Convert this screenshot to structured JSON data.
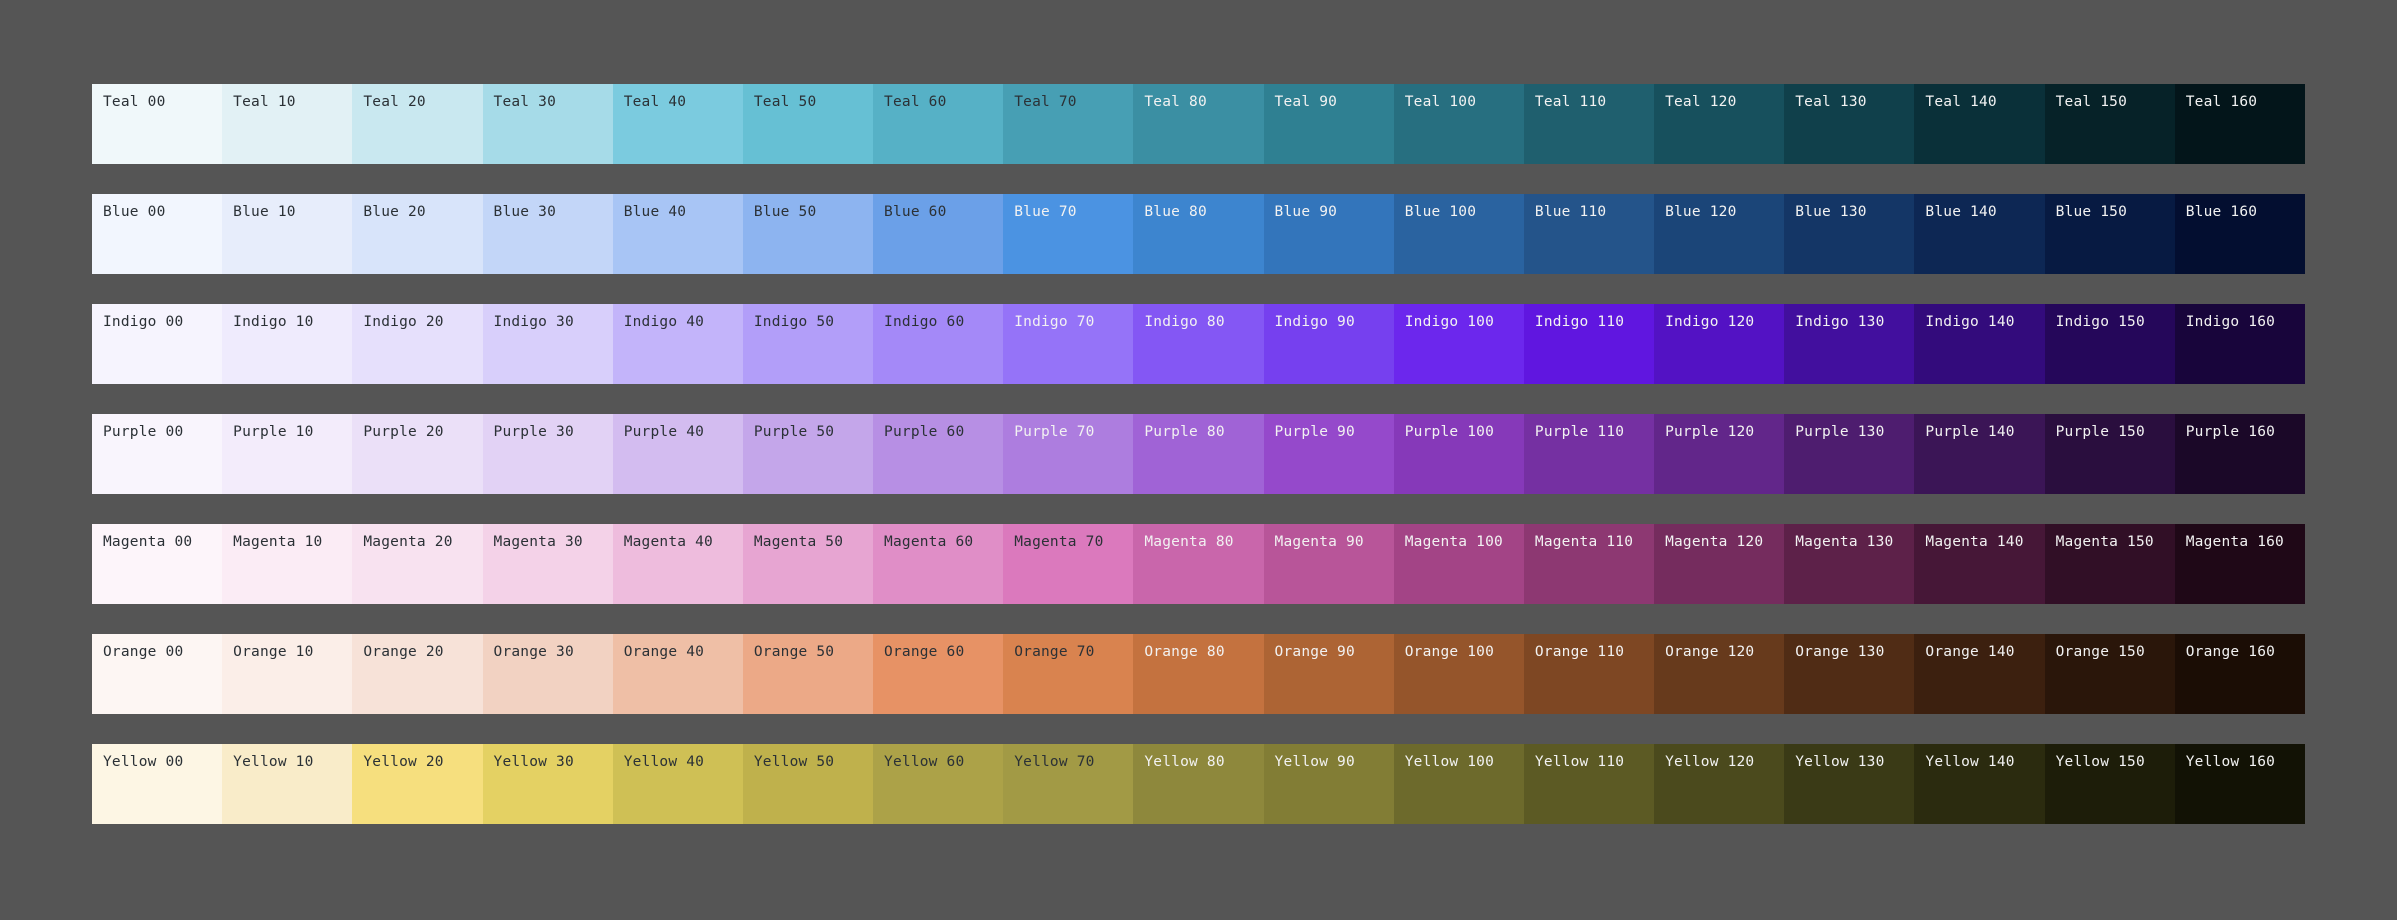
{
  "page": {
    "background_color": "#555555",
    "label_text_color_on_light": "#2b3136",
    "label_text_color_on_dark": "#f2f2f2",
    "step_labels": [
      "00",
      "10",
      "20",
      "30",
      "40",
      "50",
      "60",
      "70",
      "80",
      "90",
      "100",
      "110",
      "120",
      "130",
      "140",
      "150",
      "160"
    ]
  },
  "palette": {
    "rows": [
      {
        "name": "Teal",
        "swatches": [
          {
            "label": "Teal 00",
            "hex": "#f0f8fa",
            "text": "dark"
          },
          {
            "label": "Teal 10",
            "hex": "#e2f1f5",
            "text": "dark"
          },
          {
            "label": "Teal 20",
            "hex": "#c9e8f0",
            "text": "dark"
          },
          {
            "label": "Teal 30",
            "hex": "#a6dbe8",
            "text": "dark"
          },
          {
            "label": "Teal 40",
            "hex": "#7bcbdf",
            "text": "dark"
          },
          {
            "label": "Teal 50",
            "hex": "#66c0d4",
            "text": "dark"
          },
          {
            "label": "Teal 60",
            "hex": "#56b1c6",
            "text": "dark"
          },
          {
            "label": "Teal 70",
            "hex": "#479fb4",
            "text": "dark"
          },
          {
            "label": "Teal 80",
            "hex": "#3b8fa3",
            "text": "light"
          },
          {
            "label": "Teal 90",
            "hex": "#2f8092",
            "text": "light"
          },
          {
            "label": "Teal 100",
            "hex": "#276f80",
            "text": "light"
          },
          {
            "label": "Teal 110",
            "hex": "#1f5f6e",
            "text": "light"
          },
          {
            "label": "Teal 120",
            "hex": "#17505d",
            "text": "light"
          },
          {
            "label": "Teal 130",
            "hex": "#10404b",
            "text": "light"
          },
          {
            "label": "Teal 140",
            "hex": "#0a3039",
            "text": "light"
          },
          {
            "label": "Teal 150",
            "hex": "#062228",
            "text": "light"
          },
          {
            "label": "Teal 160",
            "hex": "#03151a",
            "text": "light"
          }
        ]
      },
      {
        "name": "Blue",
        "swatches": [
          {
            "label": "Blue 00",
            "hex": "#f2f6fe",
            "text": "dark"
          },
          {
            "label": "Blue 10",
            "hex": "#e7edfb",
            "text": "dark"
          },
          {
            "label": "Blue 20",
            "hex": "#d8e4fa",
            "text": "dark"
          },
          {
            "label": "Blue 30",
            "hex": "#c3d6f8",
            "text": "dark"
          },
          {
            "label": "Blue 40",
            "hex": "#a8c5f5",
            "text": "dark"
          },
          {
            "label": "Blue 50",
            "hex": "#8db4f0",
            "text": "dark"
          },
          {
            "label": "Blue 60",
            "hex": "#6ba0e8",
            "text": "dark"
          },
          {
            "label": "Blue 70",
            "hex": "#4b93e2",
            "text": "light"
          },
          {
            "label": "Blue 80",
            "hex": "#3d85cf",
            "text": "light"
          },
          {
            "label": "Blue 90",
            "hex": "#3375bb",
            "text": "light"
          },
          {
            "label": "Blue 100",
            "hex": "#2a63a0",
            "text": "light"
          },
          {
            "label": "Blue 110",
            "hex": "#24548a",
            "text": "light"
          },
          {
            "label": "Blue 120",
            "hex": "#1b4578",
            "text": "light"
          },
          {
            "label": "Blue 130",
            "hex": "#143666",
            "text": "light"
          },
          {
            "label": "Blue 140",
            "hex": "#0d2754",
            "text": "light"
          },
          {
            "label": "Blue 150",
            "hex": "#071a42",
            "text": "light"
          },
          {
            "label": "Blue 160",
            "hex": "#030e30",
            "text": "light"
          }
        ]
      },
      {
        "name": "Indigo",
        "swatches": [
          {
            "label": "Indigo 00",
            "hex": "#f6f4fe",
            "text": "dark"
          },
          {
            "label": "Indigo 10",
            "hex": "#efebfd",
            "text": "dark"
          },
          {
            "label": "Indigo 20",
            "hex": "#e6e0fc",
            "text": "dark"
          },
          {
            "label": "Indigo 30",
            "hex": "#d8cffb",
            "text": "dark"
          },
          {
            "label": "Indigo 40",
            "hex": "#c3b4fa",
            "text": "dark"
          },
          {
            "label": "Indigo 50",
            "hex": "#b29ef9",
            "text": "dark"
          },
          {
            "label": "Indigo 60",
            "hex": "#a489f8",
            "text": "dark"
          },
          {
            "label": "Indigo 70",
            "hex": "#9573f8",
            "text": "light"
          },
          {
            "label": "Indigo 80",
            "hex": "#8457f4",
            "text": "light"
          },
          {
            "label": "Indigo 90",
            "hex": "#7640ef",
            "text": "light"
          },
          {
            "label": "Indigo 100",
            "hex": "#6c27ed",
            "text": "light"
          },
          {
            "label": "Indigo 110",
            "hex": "#6016e0",
            "text": "light"
          },
          {
            "label": "Indigo 120",
            "hex": "#5312c4",
            "text": "light"
          },
          {
            "label": "Indigo 130",
            "hex": "#420f9e",
            "text": "light"
          },
          {
            "label": "Indigo 140",
            "hex": "#330b7c",
            "text": "light"
          },
          {
            "label": "Indigo 150",
            "hex": "#25075a",
            "text": "light"
          },
          {
            "label": "Indigo 160",
            "hex": "#18053b",
            "text": "light"
          }
        ]
      },
      {
        "name": "Purple",
        "swatches": [
          {
            "label": "Purple 00",
            "hex": "#f9f5fd",
            "text": "dark"
          },
          {
            "label": "Purple 10",
            "hex": "#f3ecfb",
            "text": "dark"
          },
          {
            "label": "Purple 20",
            "hex": "#ebe0f8",
            "text": "dark"
          },
          {
            "label": "Purple 30",
            "hex": "#e2d2f5",
            "text": "dark"
          },
          {
            "label": "Purple 40",
            "hex": "#d3bcf0",
            "text": "dark"
          },
          {
            "label": "Purple 50",
            "hex": "#c4a6ea",
            "text": "dark"
          },
          {
            "label": "Purple 60",
            "hex": "#b78fe4",
            "text": "dark"
          },
          {
            "label": "Purple 70",
            "hex": "#ad7ddf",
            "text": "light"
          },
          {
            "label": "Purple 80",
            "hex": "#a063d6",
            "text": "light"
          },
          {
            "label": "Purple 90",
            "hex": "#9549cb",
            "text": "light"
          },
          {
            "label": "Purple 100",
            "hex": "#8639b9",
            "text": "light"
          },
          {
            "label": "Purple 110",
            "hex": "#7530a2",
            "text": "light"
          },
          {
            "label": "Purple 120",
            "hex": "#62268a",
            "text": "light"
          },
          {
            "label": "Purple 130",
            "hex": "#4e1d6f",
            "text": "light"
          },
          {
            "label": "Purple 140",
            "hex": "#3b1556",
            "text": "light"
          },
          {
            "label": "Purple 150",
            "hex": "#2a0e3e",
            "text": "light"
          },
          {
            "label": "Purple 160",
            "hex": "#1b0828",
            "text": "light"
          }
        ]
      },
      {
        "name": "Magenta",
        "swatches": [
          {
            "label": "Magenta 00",
            "hex": "#fdf5fa",
            "text": "dark"
          },
          {
            "label": "Magenta 10",
            "hex": "#fbecf5",
            "text": "dark"
          },
          {
            "label": "Magenta 20",
            "hex": "#f8e2f0",
            "text": "dark"
          },
          {
            "label": "Magenta 30",
            "hex": "#f4d2e8",
            "text": "dark"
          },
          {
            "label": "Magenta 40",
            "hex": "#eebcdd",
            "text": "dark"
          },
          {
            "label": "Magenta 50",
            "hex": "#e7a5d2",
            "text": "dark"
          },
          {
            "label": "Magenta 60",
            "hex": "#e08ec7",
            "text": "dark"
          },
          {
            "label": "Magenta 70",
            "hex": "#db79bd",
            "text": "dark"
          },
          {
            "label": "Magenta 80",
            "hex": "#c966ab",
            "text": "light"
          },
          {
            "label": "Magenta 90",
            "hex": "#b85599",
            "text": "light"
          },
          {
            "label": "Magenta 100",
            "hex": "#a34486",
            "text": "light"
          },
          {
            "label": "Magenta 110",
            "hex": "#8d3872",
            "text": "light"
          },
          {
            "label": "Magenta 120",
            "hex": "#752c5e",
            "text": "light"
          },
          {
            "label": "Magenta 130",
            "hex": "#5d2149",
            "text": "light"
          },
          {
            "label": "Magenta 140",
            "hex": "#461737",
            "text": "light"
          },
          {
            "label": "Magenta 150",
            "hex": "#310f26",
            "text": "light"
          },
          {
            "label": "Magenta 160",
            "hex": "#1f0817",
            "text": "light"
          }
        ]
      },
      {
        "name": "Orange",
        "swatches": [
          {
            "label": "Orange 00",
            "hex": "#fdf6f3",
            "text": "dark"
          },
          {
            "label": "Orange 10",
            "hex": "#fbeee8",
            "text": "dark"
          },
          {
            "label": "Orange 20",
            "hex": "#f7e2d8",
            "text": "dark"
          },
          {
            "label": "Orange 30",
            "hex": "#f2d2c2",
            "text": "dark"
          },
          {
            "label": "Orange 40",
            "hex": "#efbfa6",
            "text": "dark"
          },
          {
            "label": "Orange 50",
            "hex": "#eca987",
            "text": "dark"
          },
          {
            "label": "Orange 60",
            "hex": "#e79265",
            "text": "dark"
          },
          {
            "label": "Orange 70",
            "hex": "#d9834f",
            "text": "dark"
          },
          {
            "label": "Orange 80",
            "hex": "#c4723f",
            "text": "light"
          },
          {
            "label": "Orange 90",
            "hex": "#ad6434",
            "text": "light"
          },
          {
            "label": "Orange 100",
            "hex": "#95552b",
            "text": "light"
          },
          {
            "label": "Orange 110",
            "hex": "#7e4723",
            "text": "light"
          },
          {
            "label": "Orange 120",
            "hex": "#673a1c",
            "text": "light"
          },
          {
            "label": "Orange 130",
            "hex": "#502c15",
            "text": "light"
          },
          {
            "label": "Orange 140",
            "hex": "#3c200f",
            "text": "light"
          },
          {
            "label": "Orange 150",
            "hex": "#2a160a",
            "text": "light"
          },
          {
            "label": "Orange 160",
            "hex": "#1b0d05",
            "text": "light"
          }
        ]
      },
      {
        "name": "Yellow",
        "swatches": [
          {
            "label": "Yellow 00",
            "hex": "#fdf6e4",
            "text": "dark"
          },
          {
            "label": "Yellow 10",
            "hex": "#f9ecc9",
            "text": "dark"
          },
          {
            "label": "Yellow 20",
            "hex": "#f6df7e",
            "text": "dark"
          },
          {
            "label": "Yellow 30",
            "hex": "#e4d163",
            "text": "dark"
          },
          {
            "label": "Yellow 40",
            "hex": "#cfc055",
            "text": "dark"
          },
          {
            "label": "Yellow 50",
            "hex": "#bfb14c",
            "text": "dark"
          },
          {
            "label": "Yellow 60",
            "hex": "#aca248",
            "text": "dark"
          },
          {
            "label": "Yellow 70",
            "hex": "#a29a45",
            "text": "dark"
          },
          {
            "label": "Yellow 80",
            "hex": "#8e883c",
            "text": "light"
          },
          {
            "label": "Yellow 90",
            "hex": "#827d35",
            "text": "light"
          },
          {
            "label": "Yellow 100",
            "hex": "#6d6a2c",
            "text": "light"
          },
          {
            "label": "Yellow 110",
            "hex": "#5c5a24",
            "text": "light"
          },
          {
            "label": "Yellow 120",
            "hex": "#4b4a1d",
            "text": "light"
          },
          {
            "label": "Yellow 130",
            "hex": "#3a3a16",
            "text": "light"
          },
          {
            "label": "Yellow 140",
            "hex": "#2b2b0f",
            "text": "light"
          },
          {
            "label": "Yellow 150",
            "hex": "#1d1d09",
            "text": "light"
          },
          {
            "label": "Yellow 160",
            "hex": "#121205",
            "text": "light"
          }
        ]
      }
    ]
  }
}
